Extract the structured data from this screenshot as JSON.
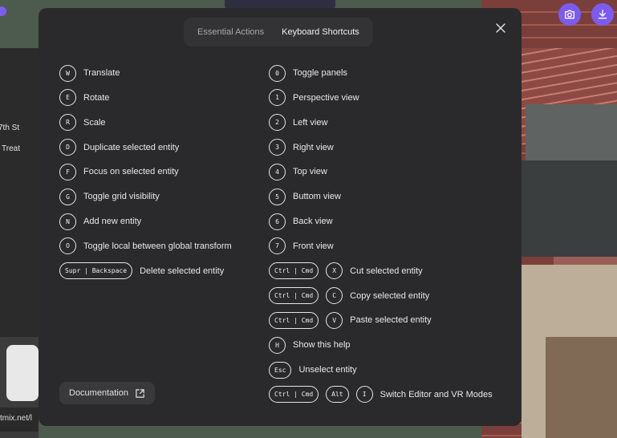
{
  "background": {
    "street_label_1": "7th St",
    "street_label_2": "Treat",
    "url_fragment": "tmix.net/l"
  },
  "toolbar": {
    "camera_icon": "camera-icon",
    "download_icon": "download-icon",
    "accent": "#7b5cf0"
  },
  "modal": {
    "tabs": [
      {
        "label": "Essential Actions",
        "active": false
      },
      {
        "label": "Keyboard Shortcuts",
        "active": true
      }
    ],
    "left_shortcuts": [
      {
        "keys": [
          "W"
        ],
        "label": "Translate"
      },
      {
        "keys": [
          "E"
        ],
        "label": "Rotate"
      },
      {
        "keys": [
          "R"
        ],
        "label": "Scale"
      },
      {
        "keys": [
          "D"
        ],
        "label": "Duplicate selected entity"
      },
      {
        "keys": [
          "F"
        ],
        "label": "Focus on selected entity"
      },
      {
        "keys": [
          "G"
        ],
        "label": "Toggle grid visibility"
      },
      {
        "keys": [
          "N"
        ],
        "label": "Add new entity"
      },
      {
        "keys": [
          "O"
        ],
        "label": "Toggle local between global transform"
      },
      {
        "keys": [
          "Supr | Backspace"
        ],
        "label": "Delete selected entity"
      }
    ],
    "right_shortcuts": [
      {
        "keys": [
          "0"
        ],
        "label": "Toggle panels"
      },
      {
        "keys": [
          "1"
        ],
        "label": "Perspective view"
      },
      {
        "keys": [
          "2"
        ],
        "label": "Left view"
      },
      {
        "keys": [
          "3"
        ],
        "label": "Right view"
      },
      {
        "keys": [
          "4"
        ],
        "label": "Top view"
      },
      {
        "keys": [
          "5"
        ],
        "label": "Buttom view"
      },
      {
        "keys": [
          "6"
        ],
        "label": "Back view"
      },
      {
        "keys": [
          "7"
        ],
        "label": "Front view"
      },
      {
        "keys": [
          "Ctrl | Cmd",
          "X"
        ],
        "label": "Cut selected entity"
      },
      {
        "keys": [
          "Ctrl | Cmd",
          "C"
        ],
        "label": "Copy selected entity"
      },
      {
        "keys": [
          "Ctrl | Cmd",
          "V"
        ],
        "label": "Paste selected entity"
      },
      {
        "keys": [
          "H"
        ],
        "label": "Show this help"
      },
      {
        "keys": [
          "Esc"
        ],
        "label": "Unselect entity"
      },
      {
        "keys": [
          "Ctrl | Cmd",
          "Alt",
          "I"
        ],
        "label": "Switch Editor and VR Modes"
      }
    ],
    "documentation_label": "Documentation"
  }
}
